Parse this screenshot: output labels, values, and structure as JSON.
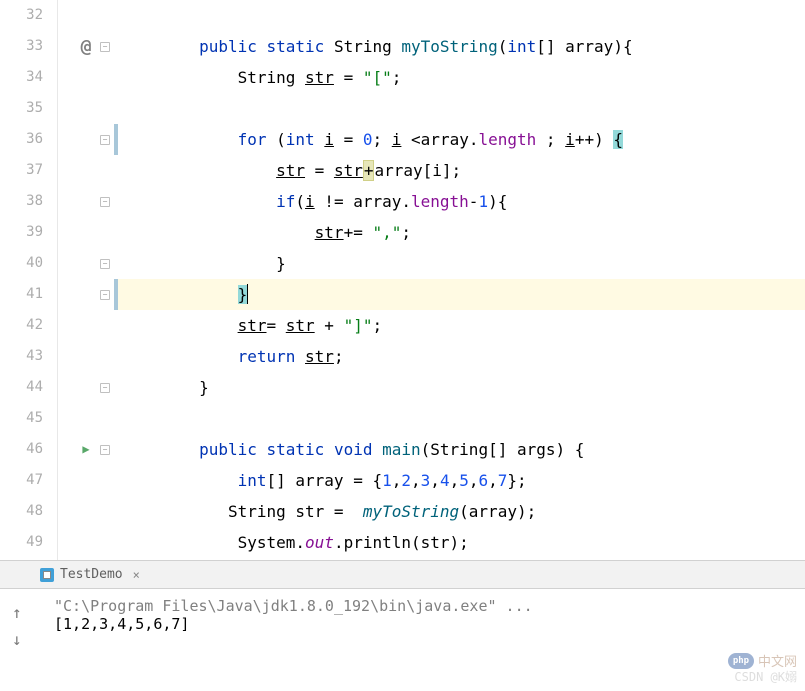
{
  "lines": {
    "l32": "",
    "l33": {
      "p1": "public",
      "p2": "static",
      "p3": "String",
      "p4": "myToString",
      "p5": "(",
      "p6": "int",
      "p7": "[] array){"
    },
    "l34": {
      "p1": "String ",
      "p2": "str",
      "p3": " = ",
      "p4": "\"[\"",
      "p5": ";"
    },
    "l35": "",
    "l36": {
      "p1": "for",
      "p2": " (",
      "p3": "int",
      "p4": " ",
      "p5": "i",
      "p6": " = ",
      "p7": "0",
      "p8": "; ",
      "p9": "i",
      "p10": " <array.",
      "p11": "length",
      "p12": " ; ",
      "p13": "i",
      "p14": "++) ",
      "p15": "{"
    },
    "l37": {
      "p1": "str",
      "p2": " = ",
      "p3": "str",
      "p4": "+",
      "p5": "array[i];"
    },
    "l38": {
      "p1": "if",
      "p2": "(",
      "p3": "i",
      "p4": " != array.",
      "p5": "length",
      "p6": "-",
      "p7": "1",
      "p8": "){"
    },
    "l39": {
      "p1": "str",
      "p2": "+= ",
      "p3": "\",\"",
      "p4": ";"
    },
    "l40": "}",
    "l41": "}",
    "l42": {
      "p1": "str",
      "p2": "= ",
      "p3": "str",
      "p4": " + ",
      "p5": "\"]\"",
      "p6": ";"
    },
    "l43": {
      "p1": "return",
      "p2": " ",
      "p3": "str",
      "p4": ";"
    },
    "l44": "}",
    "l45": "",
    "l46": {
      "p1": "public",
      "p2": "static",
      "p3": "void",
      "p4": "main",
      "p5": "(String[] args) {"
    },
    "l47": {
      "p1": "int",
      "p2": "[] array = {",
      "p3": "1",
      "p4": ",",
      "p5": "2",
      "p6": ",",
      "p7": "3",
      "p8": ",",
      "p9": "4",
      "p10": ",",
      "p11": "5",
      "p12": ",",
      "p13": "6",
      "p14": ",",
      "p15": "7",
      "p16": "};"
    },
    "l48": {
      "p1": "String str =  ",
      "p2": "myToString",
      "p3": "(array);"
    },
    "l49": {
      "p1": "System.",
      "p2": "out",
      "p3": ".println(str);"
    }
  },
  "lineNumbers": [
    "32",
    "33",
    "34",
    "35",
    "36",
    "37",
    "38",
    "39",
    "40",
    "41",
    "42",
    "43",
    "44",
    "45",
    "46",
    "47",
    "48",
    "49"
  ],
  "tab": {
    "label": "TestDemo"
  },
  "console": {
    "cmd": "\"C:\\Program Files\\Java\\jdk1.8.0_192\\bin\\java.exe\" ...",
    "output": "[1,2,3,4,5,6,7]"
  },
  "watermark": {
    "top": "中文网",
    "logo": "php",
    "bottom": "CSDN @K嫋"
  }
}
